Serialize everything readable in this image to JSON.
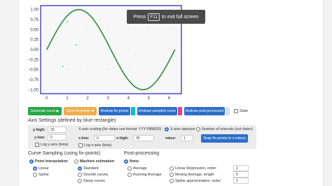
{
  "plot": {
    "y_ticks": [
      "1.00",
      "0.75",
      "0.50",
      "0.25",
      "0.00",
      "−0.25",
      "−0.50",
      "−0.75",
      "−1.00"
    ],
    "x_ticks": [
      "0",
      "1",
      "2",
      "3",
      "4",
      "5",
      "6"
    ],
    "curve_color": "#2e8b3d",
    "frame_color": "#1f1fb8"
  },
  "banner": {
    "press": "Press",
    "key": "F11",
    "rest": "to exit full screen"
  },
  "buttons": {
    "generate": "Generate curve ▶",
    "clear": "Clear fix-points ✖",
    "redraw_fix": "Redraw fix-points",
    "redraw_sampled": "Redraw sampled curve",
    "redraw_post": "Redraw post processed",
    "stats": "Stats",
    "snap": "Snap fix-points to x-values"
  },
  "swatch_colors": {
    "fix": "#00bcd4",
    "sampled": "#e83e8c",
    "post": "#e0e0e0"
  },
  "axis": {
    "title": "Axis Settings (defined by blue rectangle)",
    "y_high_label": "y-high:",
    "y_high_value": "20",
    "y_low_label": "y-low:",
    "y_low_value": "0",
    "log_y": "Log y-axis (beta)",
    "x_scaling": "X-axis scaling (for dates use format: YYYYMMDD)",
    "x_low_label": "x-low:",
    "x_low_value": "0",
    "x_high_label": "x-high:",
    "x_high_value": "30",
    "log_x": "Log x-axis (beta)",
    "stepsize": "X-axis stepsize",
    "num_intervals": "Number of intervals (not dates)",
    "value_label": "value:",
    "value_value": "1"
  },
  "sampling": {
    "title": "Curve Sampling (using fix-points)",
    "point_interp": "Point interpolation",
    "linear": "Linear",
    "spline": "Spline",
    "machine": "Machine estimation",
    "standard": "Standard",
    "smooth": "Smooth curves",
    "steep": "Steep curves"
  },
  "post": {
    "title": "Post-processing",
    "none": "None",
    "average": "Average",
    "running": "Running Average",
    "linreg": "Linear Regression, order:",
    "linreg_value": "1",
    "moving": "Moving Average, length:",
    "moving_value": "5",
    "spline_approx": "Spline approximation, order:",
    "spline_value": "1"
  }
}
